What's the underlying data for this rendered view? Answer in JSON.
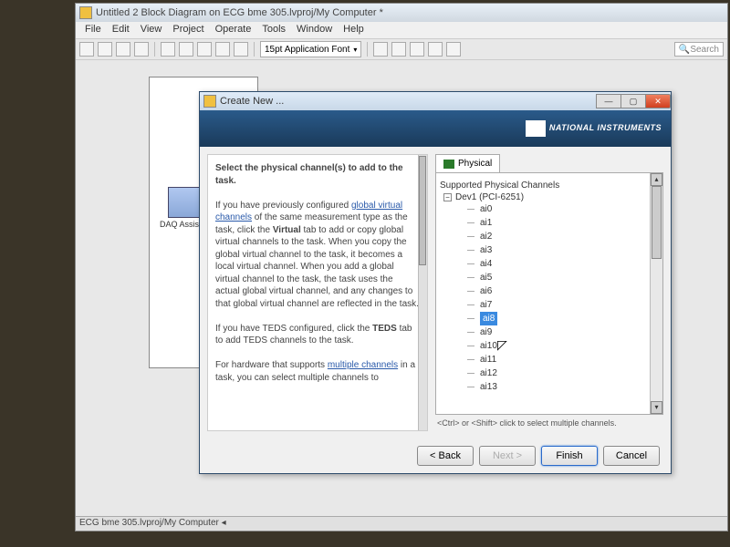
{
  "app": {
    "title": "Untitled 2 Block Diagram on ECG bme 305.lvproj/My Computer *",
    "menus": [
      "File",
      "Edit",
      "View",
      "Project",
      "Operate",
      "Tools",
      "Window",
      "Help"
    ],
    "font": "15pt Application Font",
    "search_placeholder": "Search",
    "node_label": "DAQ Assista...",
    "status": "ECG bme 305.lvproj/My Computer  ◂"
  },
  "dialog": {
    "title": "Create New ...",
    "brand": "NATIONAL INSTRUMENTS",
    "help_heading": "Select the physical channel(s) to add to the task.",
    "help_p1a": "If you have previously configured ",
    "help_link1": "global virtual channels",
    "help_p1b": " of the same measurement type as the task, click the ",
    "help_bold1": "Virtual",
    "help_p1c": " tab to add or copy global virtual channels to the task. When you copy the global virtual channel to the task, it becomes a local virtual channel. When you add a global virtual channel to the task, the task uses the actual global virtual channel, and any changes to that global virtual channel are reflected in the task.",
    "help_p2a": "If you have TEDS configured, click the ",
    "help_bold2": "TEDS",
    "help_p2b": " tab to add TEDS channels to the task.",
    "help_p3a": "For hardware that supports ",
    "help_link2": "multiple channels",
    "help_p3b": " in a task, you can select multiple channels to",
    "tab_physical": "Physical",
    "supported_label": "Supported Physical Channels",
    "device": "Dev1  (PCI-6251)",
    "channels": [
      "ai0",
      "ai1",
      "ai2",
      "ai3",
      "ai4",
      "ai5",
      "ai6",
      "ai7",
      "ai8",
      "ai9",
      "ai10",
      "ai11",
      "ai12",
      "ai13"
    ],
    "selected_index": 8,
    "hint": "<Ctrl> or <Shift> click to select multiple channels.",
    "btn_back": "< Back",
    "btn_next": "Next >",
    "btn_finish": "Finish",
    "btn_cancel": "Cancel"
  }
}
